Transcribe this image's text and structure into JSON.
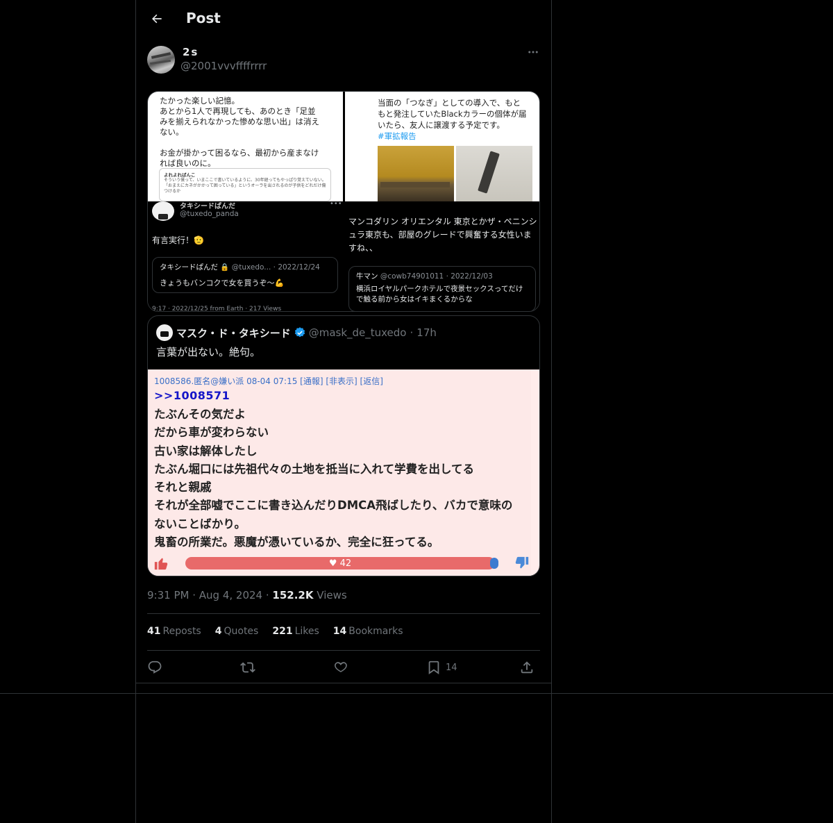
{
  "header": {
    "title": "Post"
  },
  "author": {
    "display_name": "2s",
    "handle": "@2001vvvffffrrrr"
  },
  "media": {
    "top_left": {
      "lines": [
        "たかった楽しい記憶。",
        "あとから1人で再現しても、あのとき「足並",
        "みを揃えられなかった惨めな思い出」は消え",
        "ない。",
        "",
        "お金が掛かって困るなら、最初から産まなけ",
        "れば良いのに。"
      ],
      "embed_name": "よれよればんこ",
      "embed_text": "そういう僕って、いまここで書いているように、30年経ってもやっぱり覚えていない。「おまえにカネがかかって困っている」というオーラを出されるのが子供をどれだけ傷つけるか"
    },
    "top_right": {
      "lines": [
        "当面の「つなぎ」としての導入で、もと",
        "もと発注していたBlackカラーの個体が届",
        "いたら、友人に譲渡する予定です。"
      ],
      "hashtag": "#軍拡報告"
    },
    "bottom_left": {
      "name": "タキシードぱんだ",
      "handle": "@tuxedo_panda",
      "text": "有言実行！🫡",
      "quote_name": "タキシードぱんだ 🔒",
      "quote_meta": "@tuxedo... · 2022/12/24",
      "quote_text": "きょうもバンコクで女を買うぞ〜💪",
      "footer": "9:17 · 2022/12/25 from Earth · 217 Views"
    },
    "bottom_right": {
      "text": "マンコダリン オリエンタル 東京とかザ・ペニンシュラ東京も、部屋のグレードで興奮する女性いますね、、",
      "quote_name": "牛マン",
      "quote_meta": "@cowb74901011 · 2022/12/03",
      "quote_text": "横浜ロイヤルパークホテルで夜景セックスってだけで触る前から女はイキまくるからな"
    }
  },
  "quote": {
    "name": "マスク・ド・タキシード",
    "handle": "@mask_de_tuxedo",
    "time": "17h",
    "text": "言葉が出ない。絶句。",
    "bbs": {
      "meta": "1008586.匿名@嫌い派 08-04 07:15 [通報] [非表示] [返信]",
      "ref": ">>1008571",
      "lines": [
        "たぶんその気だよ",
        "だから車が変わらない",
        "古い家は解体したし",
        "たぶん堀口には先祖代々の土地を抵当に入れて学費を出してる",
        "それと親戚",
        "それが全部嘘でここに書き込んだりDMCA飛ばしたり、バカで意味の",
        "ないことばかり。",
        "鬼畜の所業だ。悪魔が憑いているか、完全に狂ってる。"
      ],
      "votes": "♥ 42"
    }
  },
  "meta": {
    "time": "9:31 PM",
    "date": "Aug 4, 2024",
    "views_count": "152.2K",
    "views_label": "Views"
  },
  "stats": {
    "reposts": "41",
    "reposts_label": "Reposts",
    "quotes": "4",
    "quotes_label": "Quotes",
    "likes": "221",
    "likes_label": "Likes",
    "bookmarks": "14",
    "bookmarks_label": "Bookmarks"
  },
  "actions": {
    "bookmark_count": "14"
  },
  "icons": {
    "back": "arrow-left-icon",
    "more": "more-icon",
    "verified": "verified-badge-icon",
    "reply": "reply-icon",
    "repost": "repost-icon",
    "like": "heart-icon",
    "bookmark": "bookmark-icon",
    "share": "share-icon"
  },
  "colors": {
    "background": "#000000",
    "text": "#e7e9ea",
    "muted": "#71767b",
    "border": "#2f3336",
    "accent": "#1d9bf0",
    "vote_bar": "#e86a6a"
  }
}
